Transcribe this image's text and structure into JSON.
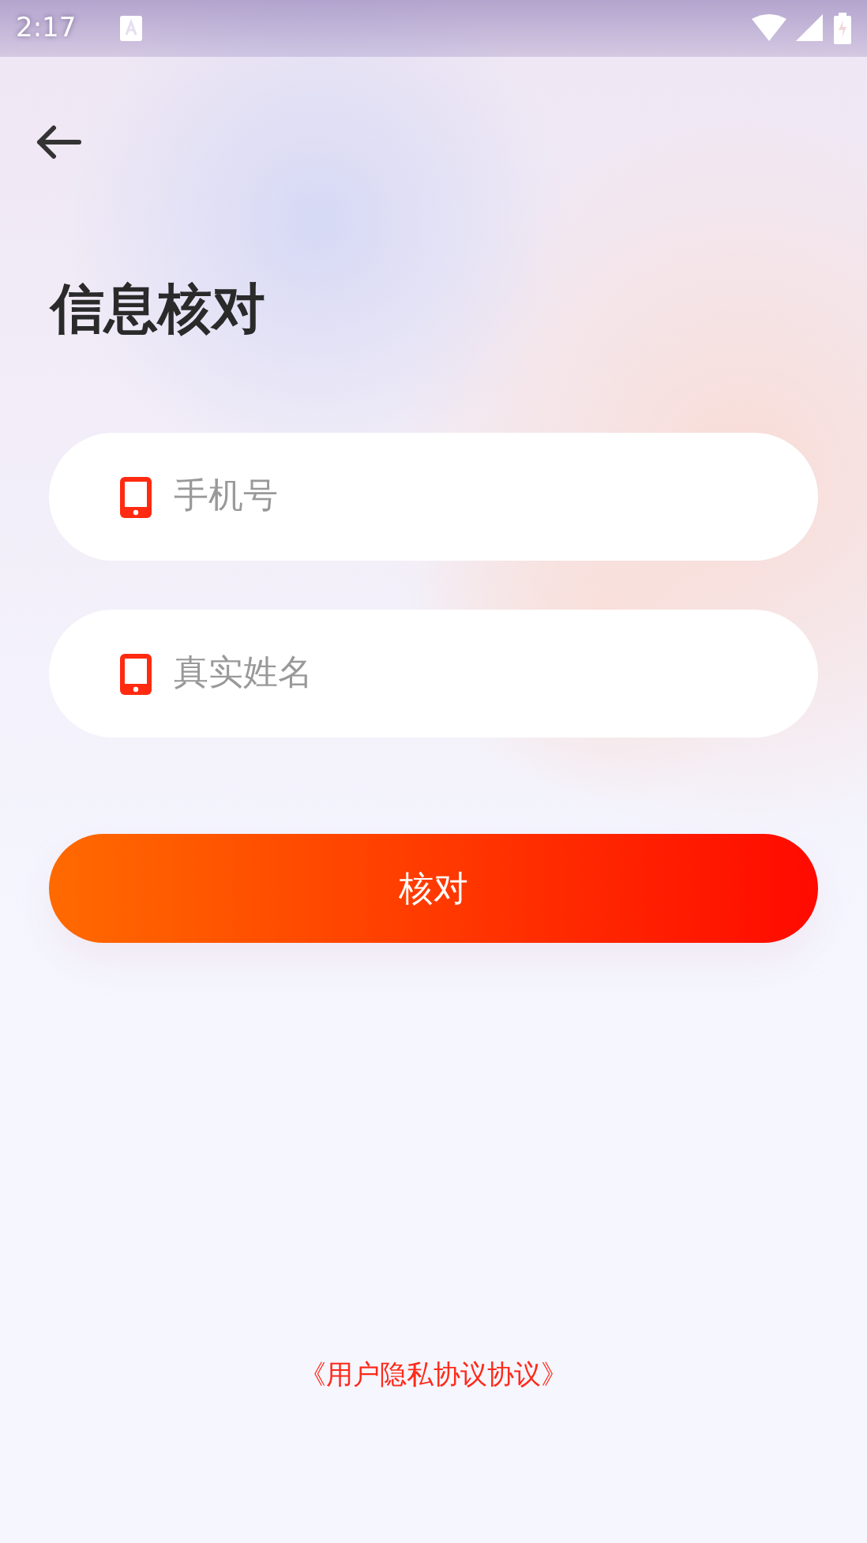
{
  "status_bar": {
    "time": "2:17"
  },
  "title": "信息核对",
  "fields": [
    {
      "placeholder": "手机号"
    },
    {
      "placeholder": "真实姓名"
    }
  ],
  "submit_button": "核对",
  "agreement_link": "《用户隐私协议协议》"
}
